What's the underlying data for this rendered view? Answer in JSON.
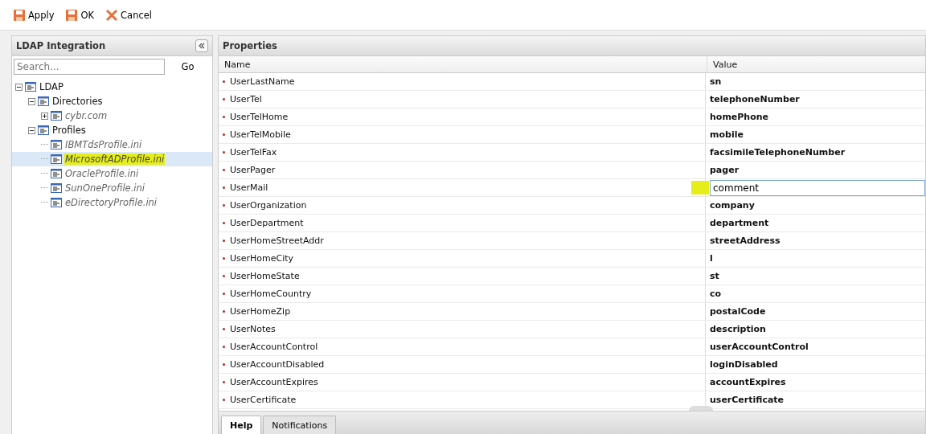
{
  "toolbar": [
    {
      "label": "Apply",
      "kind": "save"
    },
    {
      "label": "OK",
      "kind": "save"
    },
    {
      "label": "Cancel",
      "kind": "cancel"
    }
  ],
  "left_panel": {
    "title": "LDAP Integration",
    "search": {
      "placeholder": "Search...",
      "button": "Go"
    },
    "tree": [
      {
        "label": "LDAP",
        "kind": "folder",
        "expanded": true,
        "selected": false,
        "highlighted": false,
        "children": [
          {
            "label": "Directories",
            "kind": "folder",
            "expanded": true,
            "selected": false,
            "highlighted": false,
            "children": [
              {
                "label": "cybr.com",
                "kind": "file",
                "expanded": false,
                "selected": false,
                "highlighted": false
              }
            ]
          },
          {
            "label": "Profiles",
            "kind": "folder",
            "expanded": true,
            "selected": false,
            "highlighted": false,
            "children": [
              {
                "label": "IBMTdsProfile.ini",
                "kind": "file",
                "selected": false,
                "highlighted": false
              },
              {
                "label": "MicrosoftADProfile.ini",
                "kind": "file",
                "selected": true,
                "highlighted": true
              },
              {
                "label": "OracleProfile.ini",
                "kind": "file",
                "selected": false,
                "highlighted": false
              },
              {
                "label": "SunOneProfile.ini",
                "kind": "file",
                "selected": false,
                "highlighted": false
              },
              {
                "label": "eDirectoryProfile.ini",
                "kind": "file",
                "selected": false,
                "highlighted": false
              }
            ]
          }
        ]
      }
    ]
  },
  "properties": {
    "title": "Properties",
    "columns": [
      "Name",
      "Value"
    ],
    "rows": [
      {
        "name": "UserLastName",
        "value": "sn",
        "editing": false
      },
      {
        "name": "UserTel",
        "value": "telephoneNumber",
        "editing": false
      },
      {
        "name": "UserTelHome",
        "value": "homePhone",
        "editing": false
      },
      {
        "name": "UserTelMobile",
        "value": "mobile",
        "editing": false
      },
      {
        "name": "UserTelFax",
        "value": "facsimileTelephoneNumber",
        "editing": false
      },
      {
        "name": "UserPager",
        "value": "pager",
        "editing": false
      },
      {
        "name": "UserMail",
        "value": "comment",
        "editing": true
      },
      {
        "name": "UserOrganization",
        "value": "company",
        "editing": false
      },
      {
        "name": "UserDepartment",
        "value": "department",
        "editing": false
      },
      {
        "name": "UserHomeStreetAddr",
        "value": "streetAddress",
        "editing": false
      },
      {
        "name": "UserHomeCity",
        "value": "l",
        "editing": false
      },
      {
        "name": "UserHomeState",
        "value": "st",
        "editing": false
      },
      {
        "name": "UserHomeCountry",
        "value": "co",
        "editing": false
      },
      {
        "name": "UserHomeZip",
        "value": "postalCode",
        "editing": false
      },
      {
        "name": "UserNotes",
        "value": "description",
        "editing": false
      },
      {
        "name": "UserAccountControl",
        "value": "userAccountControl",
        "editing": false
      },
      {
        "name": "UserAccountDisabled",
        "value": "loginDisabled",
        "editing": false
      },
      {
        "name": "UserAccountExpires",
        "value": "accountExpires",
        "editing": false
      },
      {
        "name": "UserCertificate",
        "value": "userCertificate",
        "editing": false
      }
    ]
  },
  "bottom_tabs": [
    {
      "label": "Help",
      "selected": true
    },
    {
      "label": "Notifications",
      "selected": false
    }
  ]
}
